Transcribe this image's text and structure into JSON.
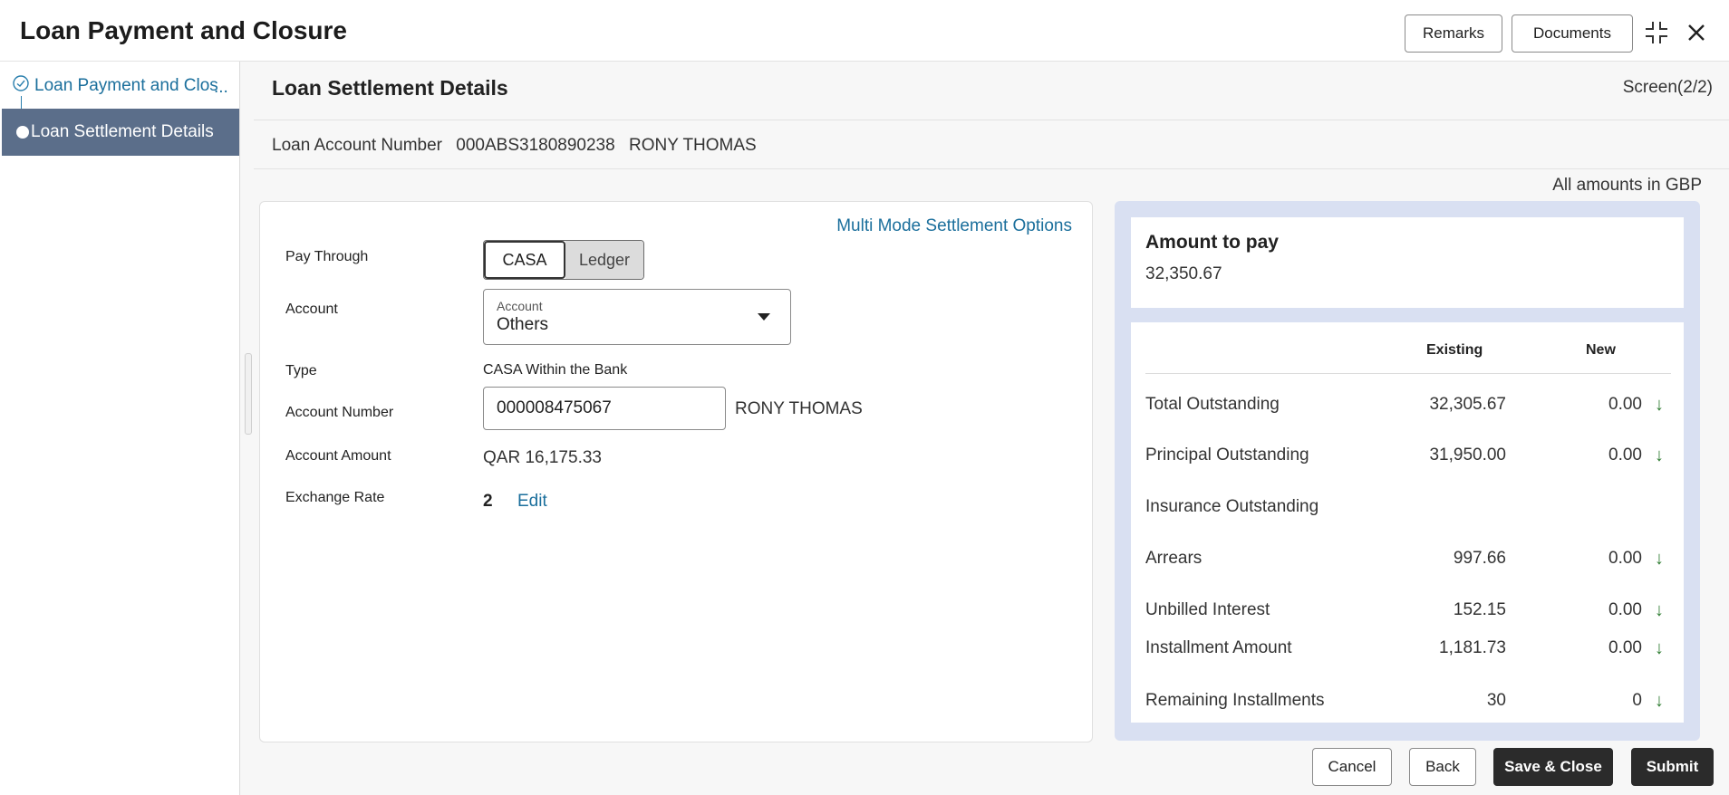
{
  "header": {
    "title": "Loan Payment and Closure",
    "remarks_label": "Remarks",
    "documents_label": "Documents"
  },
  "sidebar": {
    "items": [
      {
        "label": "Loan Payment and Clos",
        "overflow": "..."
      },
      {
        "label": "Loan Settlement Details"
      }
    ]
  },
  "main": {
    "section_title": "Loan Settlement Details",
    "screen_indicator": "Screen(2/2)",
    "loan_account": {
      "label": "Loan Account Number",
      "number": "000ABS3180890238",
      "name": "RONY THOMAS"
    },
    "amounts_note": "All amounts in GBP"
  },
  "form": {
    "multi_mode_link": "Multi Mode Settlement Options",
    "pay_through": {
      "label": "Pay Through",
      "options": [
        "CASA",
        "Ledger"
      ],
      "selected": "CASA"
    },
    "account": {
      "label": "Account",
      "select_label": "Account",
      "value": "Others"
    },
    "type": {
      "label": "Type",
      "value": "CASA Within the Bank"
    },
    "account_number": {
      "label": "Account Number",
      "value": "000008475067",
      "holder": "RONY THOMAS"
    },
    "account_amount": {
      "label": "Account Amount",
      "value": "QAR 16,175.33"
    },
    "exchange_rate": {
      "label": "Exchange Rate",
      "value": "2",
      "edit_label": "Edit"
    }
  },
  "summary": {
    "amount_to_pay_label": "Amount to pay",
    "amount_to_pay": "32,350.67",
    "col_existing": "Existing",
    "col_new": "New",
    "rows": [
      {
        "label": "Total Outstanding",
        "existing": "32,305.67",
        "new": "0.00",
        "arrow": "↓"
      },
      {
        "label": "Principal Outstanding",
        "existing": "31,950.00",
        "new": "0.00",
        "arrow": "↓"
      },
      {
        "label": "Insurance Outstanding",
        "existing": "",
        "new": "",
        "arrow": ""
      },
      {
        "label": "Arrears",
        "existing": "997.66",
        "new": "0.00",
        "arrow": "↓"
      },
      {
        "label": "Unbilled Interest",
        "existing": "152.15",
        "new": "0.00",
        "arrow": "↓"
      },
      {
        "label": "Installment Amount",
        "existing": "1,181.73",
        "new": "0.00",
        "arrow": "↓"
      },
      {
        "label": "Remaining Installments",
        "existing": "30",
        "new": "0",
        "arrow": "↓"
      }
    ]
  },
  "footer": {
    "cancel_label": "Cancel",
    "back_label": "Back",
    "save_close_label": "Save & Close",
    "submit_label": "Submit"
  },
  "icons": {
    "collapse": "collapse-icon",
    "close": "close-icon",
    "step_done": "check-circle-icon"
  }
}
